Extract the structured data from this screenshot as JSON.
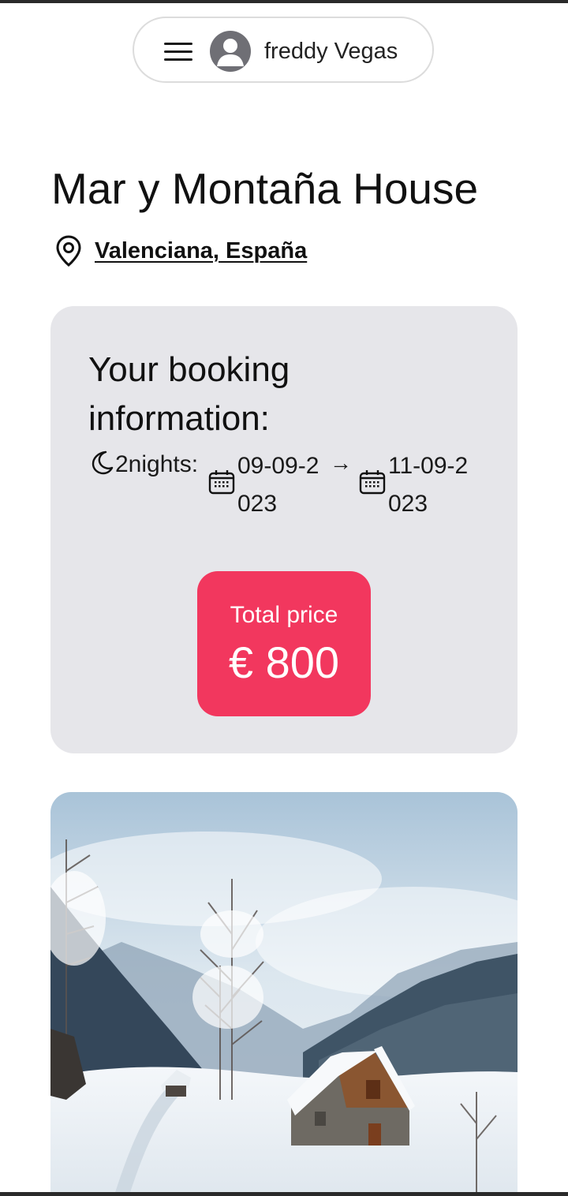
{
  "header": {
    "user_name": "freddy Vegas",
    "menu_icon": "hamburger-menu-icon",
    "avatar_icon": "user-avatar-icon"
  },
  "listing": {
    "title": "Mar y Montaña House",
    "location": "Valenciana, España",
    "location_icon": "map-pin-icon"
  },
  "booking": {
    "heading": "Your booking information:",
    "nights": "2nights:",
    "check_in": "09-09-2023",
    "arrow": "→",
    "check_out": "11-09-2023",
    "moon_icon": "moon-icon",
    "calendar_icon": "calendar-icon",
    "card_color": "#e6e6ea"
  },
  "price": {
    "label": "Total price",
    "value": "€ 800",
    "accent_color": "#f2375e"
  }
}
